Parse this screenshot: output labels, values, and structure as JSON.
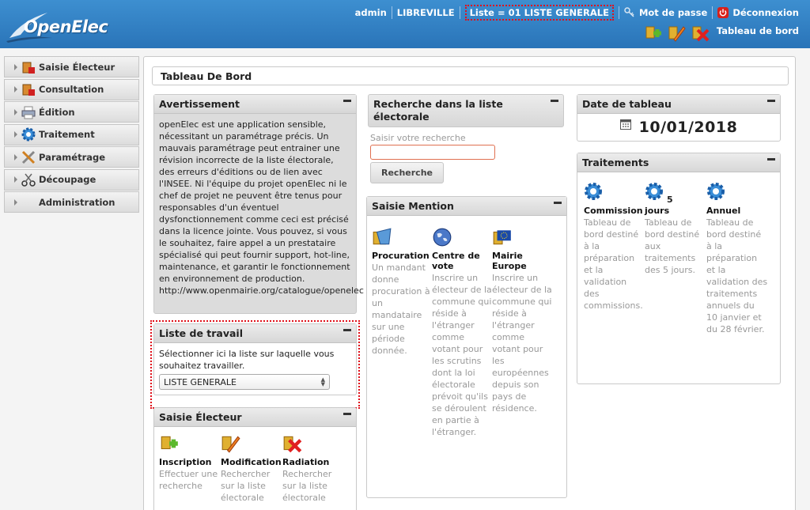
{
  "header": {
    "logo_text": "OpenElec",
    "user": "admin",
    "city": "LIBREVILLE",
    "list_label": "Liste = 01 LISTE GENERALE",
    "password_label": "Mot de passe",
    "logout_label": "Déconnexion",
    "dashboard_label": "Tableau de bord",
    "icons": [
      "add-elector-icon",
      "edit-elector-icon",
      "delete-elector-icon"
    ]
  },
  "sidebar": {
    "items": [
      {
        "label": "Saisie Électeur",
        "icon": "elector-input-icon"
      },
      {
        "label": "Consultation",
        "icon": "consultation-icon"
      },
      {
        "label": "Édition",
        "icon": "printer-icon"
      },
      {
        "label": "Traitement",
        "icon": "gear-icon"
      },
      {
        "label": "Paramétrage",
        "icon": "tools-icon"
      },
      {
        "label": "Découpage",
        "icon": "scissors-icon"
      },
      {
        "label": "Administration",
        "icon": ""
      }
    ]
  },
  "main": {
    "title": "Tableau De Bord",
    "warning": {
      "title": "Avertissement",
      "text": "openElec est une application sensible, nécessitant un paramétrage précis. Un mauvais paramétrage peut entrainer une révision incorrecte de la liste électorale, des erreurs d'éditions ou de lien avec l'INSEE. Ni l'équipe du projet openElec ni le chef de projet ne peuvent être tenus pour responsables d'un éventuel dysfonctionnement comme ceci est précisé dans la licence jointe. Vous pouvez, si vous le souhaitez, faire appel a un prestataire spécialisé qui peut fournir support, hot-line, maintenance, et garantir le fonctionnement en environnement de production. http://www.openmairie.org/catalogue/openelec"
    },
    "work_list": {
      "title": "Liste de travail",
      "text": "Sélectionner ici la liste sur laquelle vous souhaitez travailler.",
      "selected": "LISTE GENERALE"
    },
    "saisie": {
      "title": "Saisie Électeur",
      "actions": [
        {
          "title": "Inscription",
          "desc": "Effectuer une recherche",
          "icon": "add-elector-icon"
        },
        {
          "title": "Modification",
          "desc": "Rechercher sur la liste électorale",
          "icon": "edit-elector-icon"
        },
        {
          "title": "Radiation",
          "desc": "Rechercher sur la liste électorale",
          "icon": "delete-elector-icon"
        }
      ]
    },
    "search": {
      "title": "Recherche dans la liste électorale",
      "placeholder_label": "Saisir votre recherche",
      "button": "Recherche"
    },
    "mention": {
      "title": "Saisie Mention",
      "actions": [
        {
          "title": "Procuration",
          "desc": "Un mandant donne procuration à un mandataire sur une période donnée.",
          "icon": "proxy-icon"
        },
        {
          "title": "Centre de vote",
          "desc": "Inscrire un électeur de la commune qui réside à l'étranger comme votant pour les scrutins dont la loi électorale prévoit qu'ils se déroulent en partie à l'étranger.",
          "icon": "globe-icon"
        },
        {
          "title": "Mairie Europe",
          "desc": "Inscrire un électeur de la commune qui réside à l'étranger comme votant pour les européennes depuis son pays de résidence.",
          "icon": "eu-flag-icon"
        }
      ]
    },
    "date": {
      "title": "Date de tableau",
      "value": "10/01/2018"
    },
    "treatments": {
      "title": "Traitements",
      "items": [
        {
          "title": "Commission",
          "badge": "",
          "desc": "Tableau de bord destiné à la préparation et la validation des commissions."
        },
        {
          "title": "jours",
          "badge": "5",
          "desc": "Tableau de bord destiné aux traitements des 5 jours."
        },
        {
          "title": "Annuel",
          "badge": "",
          "desc": "Tableau de bord destiné à la préparation et la validation des traitements annuels du 10 janvier et du 28 février."
        }
      ]
    }
  }
}
